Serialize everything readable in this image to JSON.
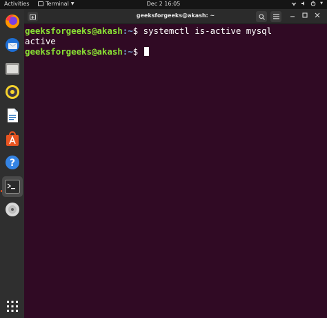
{
  "topbar": {
    "activities": "Activities",
    "app_name": "Terminal",
    "clock": "Dec 2  16:05"
  },
  "dock": {
    "items": [
      {
        "name": "firefox-icon"
      },
      {
        "name": "thunderbird-icon"
      },
      {
        "name": "files-icon"
      },
      {
        "name": "rhythmbox-icon"
      },
      {
        "name": "writer-icon"
      },
      {
        "name": "software-icon"
      },
      {
        "name": "help-icon"
      },
      {
        "name": "terminal-icon",
        "active": true
      },
      {
        "name": "dvd-icon"
      },
      {
        "name": "show-apps-icon"
      }
    ]
  },
  "window": {
    "title": "geeksforgeeks@akash: ~",
    "lines": [
      {
        "prompt_user": "geeksforgeeks@akash",
        "prompt_path": ":~",
        "prompt_symbol": "$ ",
        "command": "systemctl is-active mysql"
      },
      {
        "output": "active"
      },
      {
        "prompt_user": "geeksforgeeks@akash",
        "prompt_path": ":~",
        "prompt_symbol": "$ ",
        "command": ""
      }
    ]
  },
  "colors": {
    "terminal_bg": "#300a24",
    "prompt_user": "#8ae234",
    "prompt_path": "#729fcf",
    "accent": "#e95420"
  }
}
